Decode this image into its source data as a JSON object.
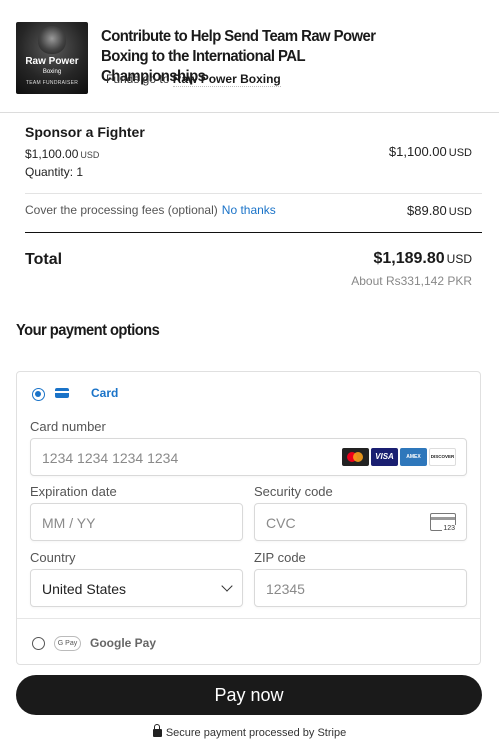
{
  "campaign": {
    "title": "Contribute to Help Send Team Raw Power Boxing to the International PAL Championships",
    "funds_prefix": "Funds go to",
    "recipient": "Raw Power Boxing",
    "logo_line1": "Raw Power",
    "logo_line2": "Boxing",
    "logo_line3": "TEAM FUNDRAISER"
  },
  "order": {
    "item_name": "Sponsor a Fighter",
    "unit_price": "$1,100.00",
    "currency": "USD",
    "quantity": "Quantity: 1",
    "line_total": "$1,100.00",
    "fees_label": "Cover the processing fees (optional)",
    "fees_link": "No thanks",
    "fees_amount": "$89.80",
    "total_label": "Total",
    "total_amount": "$1,189.80",
    "total_local": "About Rs331,142 PKR"
  },
  "payment": {
    "heading": "Your payment options",
    "card_option": "Card",
    "card_number_label": "Card number",
    "card_number_placeholder": "1234 1234 1234 1234",
    "expiry_label": "Expiration date",
    "expiry_placeholder": "MM / YY",
    "cvc_label": "Security code",
    "cvc_placeholder": "CVC",
    "cvc_icon_text": "123",
    "country_label": "Country",
    "country_value": "United States",
    "zip_label": "ZIP code",
    "zip_placeholder": "12345",
    "brands": {
      "visa": "VISA",
      "amex": "AMEX",
      "discover": "DISCOVER"
    },
    "gpay_badge": "G Pay",
    "gpay_label": "Google Pay",
    "selected": "card"
  },
  "actions": {
    "pay_button": "Pay now",
    "secure_note": "Secure payment processed by Stripe"
  },
  "colors": {
    "accent": "#1a73c8",
    "button": "#1a1a1a"
  }
}
